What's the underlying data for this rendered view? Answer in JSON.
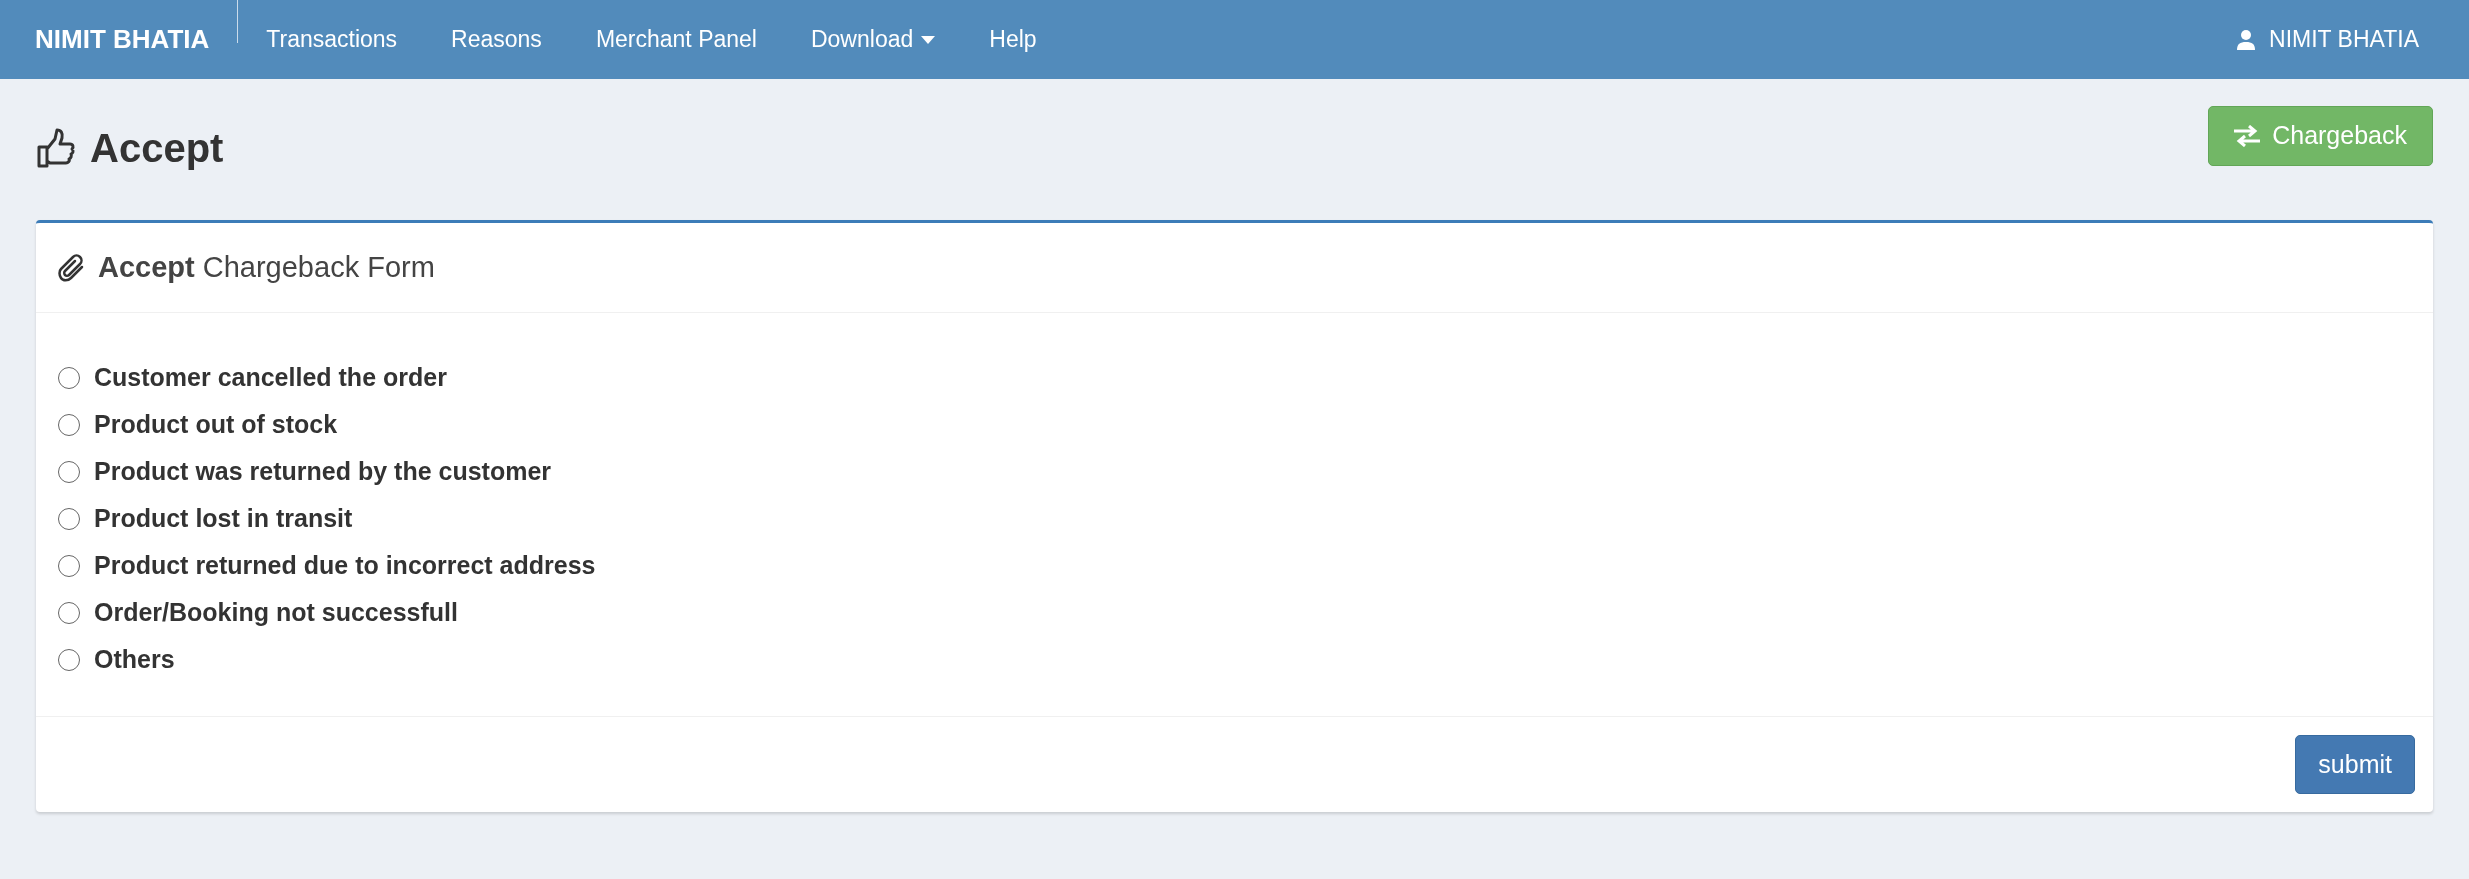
{
  "navbar": {
    "brand": "NIMIT BHATIA",
    "items": [
      {
        "label": "Transactions",
        "dropdown": false
      },
      {
        "label": "Reasons",
        "dropdown": false
      },
      {
        "label": "Merchant Panel",
        "dropdown": false
      },
      {
        "label": "Download",
        "dropdown": true
      },
      {
        "label": "Help",
        "dropdown": false
      }
    ],
    "user": "NIMIT BHATIA"
  },
  "page": {
    "title": "Accept",
    "action_button": "Chargeback"
  },
  "form": {
    "title": "**Accept** Chargeback Form",
    "options": [
      {
        "label": "Customer cancelled the order",
        "selected": false
      },
      {
        "label": "Product out of stock",
        "selected": false
      },
      {
        "label": "Product was returned by the customer",
        "selected": false
      },
      {
        "label": "Product lost in transit",
        "selected": false
      },
      {
        "label": "Product returned due to incorrect address",
        "selected": false
      },
      {
        "label": "Order/Booking not successfull",
        "selected": false
      },
      {
        "label": "Others",
        "selected": false
      }
    ],
    "submit": "submit"
  }
}
